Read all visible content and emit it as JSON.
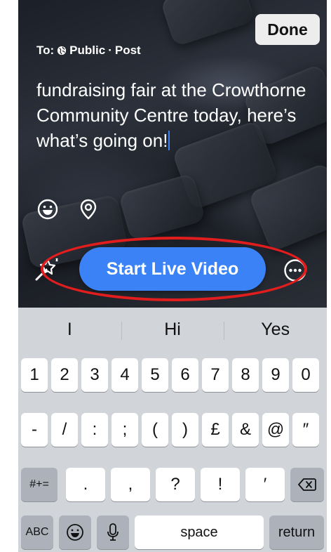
{
  "header": {
    "done_label": "Done",
    "to_prefix": "To:",
    "audience": "Public",
    "separator": "·",
    "post_type": "Post"
  },
  "composer": {
    "text": "fundraising fair at the Crowthorne Community Centre today, here’s what’s going on!"
  },
  "actions": {
    "start_live_label": "Start Live Video"
  },
  "keyboard": {
    "suggestions": [
      "I",
      "Hi",
      "Yes"
    ],
    "row1": [
      "1",
      "2",
      "3",
      "4",
      "5",
      "6",
      "7",
      "8",
      "9",
      "0"
    ],
    "row2": [
      "-",
      "/",
      ":",
      ";",
      "(",
      ")",
      "£",
      "&",
      "@",
      "″"
    ],
    "row3_mode": "#+=",
    "row3": [
      ".",
      ",",
      "?",
      "!",
      "′"
    ],
    "abc_label": "ABC",
    "space_label": "space",
    "return_label": "return"
  },
  "colors": {
    "accent_blue": "#3b82f6",
    "highlight_red": "#e11d1d",
    "keyboard_bg": "#d1d4d9"
  }
}
